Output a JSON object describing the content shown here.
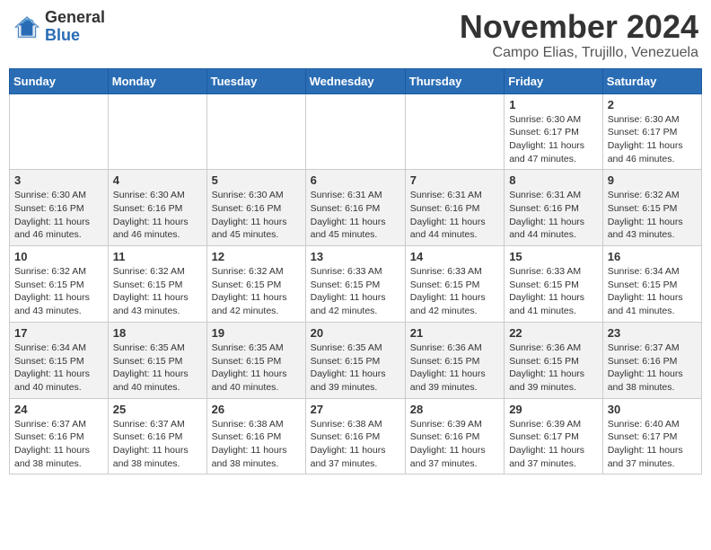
{
  "header": {
    "logo_general": "General",
    "logo_blue": "Blue",
    "month_year": "November 2024",
    "location": "Campo Elias, Trujillo, Venezuela"
  },
  "weekdays": [
    "Sunday",
    "Monday",
    "Tuesday",
    "Wednesday",
    "Thursday",
    "Friday",
    "Saturday"
  ],
  "weeks": [
    [
      {
        "day": "",
        "info": ""
      },
      {
        "day": "",
        "info": ""
      },
      {
        "day": "",
        "info": ""
      },
      {
        "day": "",
        "info": ""
      },
      {
        "day": "",
        "info": ""
      },
      {
        "day": "1",
        "info": "Sunrise: 6:30 AM\nSunset: 6:17 PM\nDaylight: 11 hours and 47 minutes."
      },
      {
        "day": "2",
        "info": "Sunrise: 6:30 AM\nSunset: 6:17 PM\nDaylight: 11 hours and 46 minutes."
      }
    ],
    [
      {
        "day": "3",
        "info": "Sunrise: 6:30 AM\nSunset: 6:16 PM\nDaylight: 11 hours and 46 minutes."
      },
      {
        "day": "4",
        "info": "Sunrise: 6:30 AM\nSunset: 6:16 PM\nDaylight: 11 hours and 46 minutes."
      },
      {
        "day": "5",
        "info": "Sunrise: 6:30 AM\nSunset: 6:16 PM\nDaylight: 11 hours and 45 minutes."
      },
      {
        "day": "6",
        "info": "Sunrise: 6:31 AM\nSunset: 6:16 PM\nDaylight: 11 hours and 45 minutes."
      },
      {
        "day": "7",
        "info": "Sunrise: 6:31 AM\nSunset: 6:16 PM\nDaylight: 11 hours and 44 minutes."
      },
      {
        "day": "8",
        "info": "Sunrise: 6:31 AM\nSunset: 6:16 PM\nDaylight: 11 hours and 44 minutes."
      },
      {
        "day": "9",
        "info": "Sunrise: 6:32 AM\nSunset: 6:15 PM\nDaylight: 11 hours and 43 minutes."
      }
    ],
    [
      {
        "day": "10",
        "info": "Sunrise: 6:32 AM\nSunset: 6:15 PM\nDaylight: 11 hours and 43 minutes."
      },
      {
        "day": "11",
        "info": "Sunrise: 6:32 AM\nSunset: 6:15 PM\nDaylight: 11 hours and 43 minutes."
      },
      {
        "day": "12",
        "info": "Sunrise: 6:32 AM\nSunset: 6:15 PM\nDaylight: 11 hours and 42 minutes."
      },
      {
        "day": "13",
        "info": "Sunrise: 6:33 AM\nSunset: 6:15 PM\nDaylight: 11 hours and 42 minutes."
      },
      {
        "day": "14",
        "info": "Sunrise: 6:33 AM\nSunset: 6:15 PM\nDaylight: 11 hours and 42 minutes."
      },
      {
        "day": "15",
        "info": "Sunrise: 6:33 AM\nSunset: 6:15 PM\nDaylight: 11 hours and 41 minutes."
      },
      {
        "day": "16",
        "info": "Sunrise: 6:34 AM\nSunset: 6:15 PM\nDaylight: 11 hours and 41 minutes."
      }
    ],
    [
      {
        "day": "17",
        "info": "Sunrise: 6:34 AM\nSunset: 6:15 PM\nDaylight: 11 hours and 40 minutes."
      },
      {
        "day": "18",
        "info": "Sunrise: 6:35 AM\nSunset: 6:15 PM\nDaylight: 11 hours and 40 minutes."
      },
      {
        "day": "19",
        "info": "Sunrise: 6:35 AM\nSunset: 6:15 PM\nDaylight: 11 hours and 40 minutes."
      },
      {
        "day": "20",
        "info": "Sunrise: 6:35 AM\nSunset: 6:15 PM\nDaylight: 11 hours and 39 minutes."
      },
      {
        "day": "21",
        "info": "Sunrise: 6:36 AM\nSunset: 6:15 PM\nDaylight: 11 hours and 39 minutes."
      },
      {
        "day": "22",
        "info": "Sunrise: 6:36 AM\nSunset: 6:15 PM\nDaylight: 11 hours and 39 minutes."
      },
      {
        "day": "23",
        "info": "Sunrise: 6:37 AM\nSunset: 6:16 PM\nDaylight: 11 hours and 38 minutes."
      }
    ],
    [
      {
        "day": "24",
        "info": "Sunrise: 6:37 AM\nSunset: 6:16 PM\nDaylight: 11 hours and 38 minutes."
      },
      {
        "day": "25",
        "info": "Sunrise: 6:37 AM\nSunset: 6:16 PM\nDaylight: 11 hours and 38 minutes."
      },
      {
        "day": "26",
        "info": "Sunrise: 6:38 AM\nSunset: 6:16 PM\nDaylight: 11 hours and 38 minutes."
      },
      {
        "day": "27",
        "info": "Sunrise: 6:38 AM\nSunset: 6:16 PM\nDaylight: 11 hours and 37 minutes."
      },
      {
        "day": "28",
        "info": "Sunrise: 6:39 AM\nSunset: 6:16 PM\nDaylight: 11 hours and 37 minutes."
      },
      {
        "day": "29",
        "info": "Sunrise: 6:39 AM\nSunset: 6:17 PM\nDaylight: 11 hours and 37 minutes."
      },
      {
        "day": "30",
        "info": "Sunrise: 6:40 AM\nSunset: 6:17 PM\nDaylight: 11 hours and 37 minutes."
      }
    ]
  ]
}
